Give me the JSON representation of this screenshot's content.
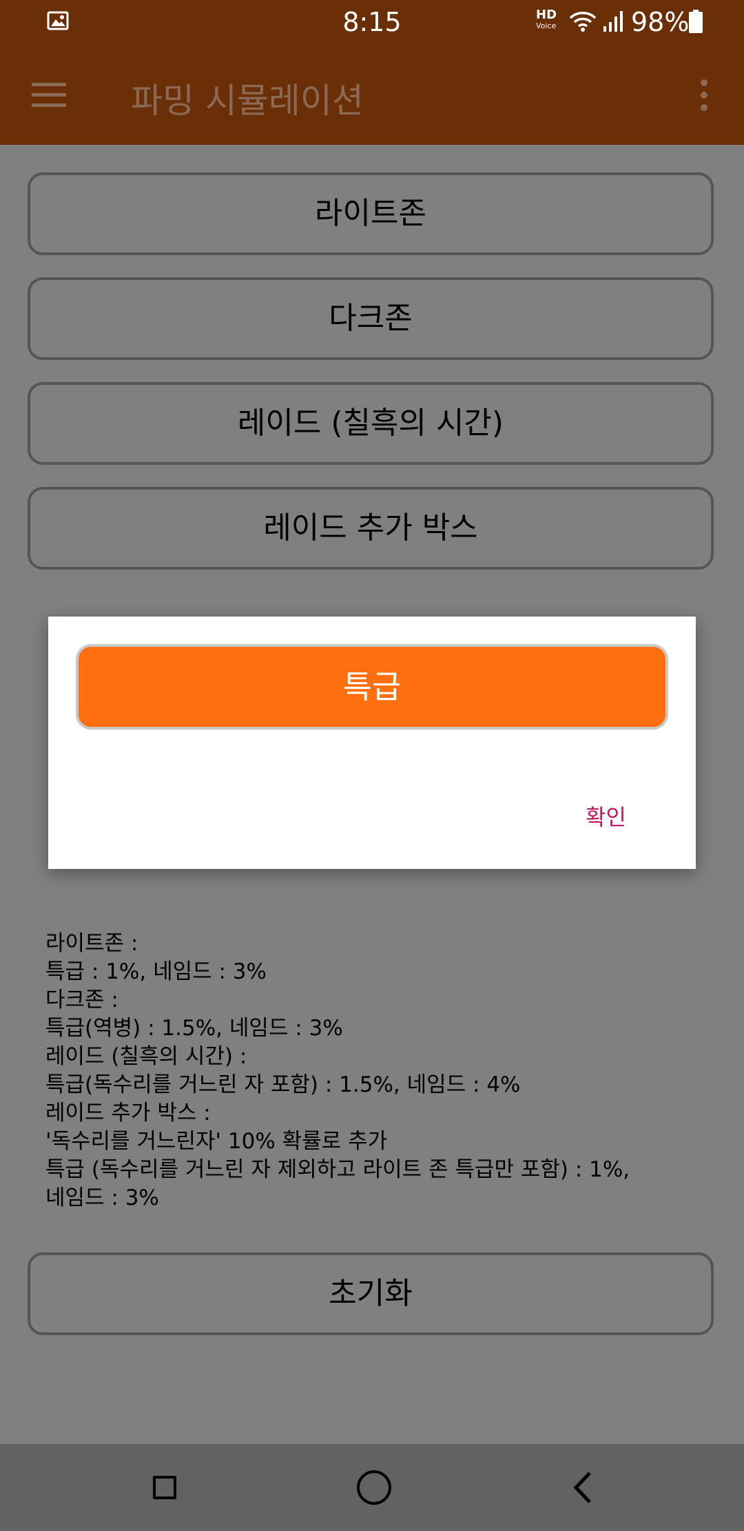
{
  "status_bar": {
    "time": "8:15",
    "hd_label": "HD",
    "voice_label": "Voice",
    "battery_percent": "98%",
    "icons": [
      "gallery-icon",
      "wifi-icon",
      "signal-icon",
      "battery-icon"
    ]
  },
  "app_bar": {
    "title": "파밍 시뮬레이션",
    "icons": [
      "menu-icon",
      "more-vert-icon"
    ]
  },
  "buttons": {
    "light_zone": "라이트존",
    "dark_zone": "다크존",
    "raid": "레이드 (칠흑의 시간)",
    "raid_box": "레이드 추가 박스",
    "reset": "초기화"
  },
  "info_lines": [
    "라이트존 :",
    "특급 : 1%, 네임드 : 3%",
    "다크존 :",
    "특급(역병) : 1.5%, 네임드 : 3%",
    "레이드 (칠흑의 시간) :",
    "특급(독수리를 거느린 자 포함) : 1.5%, 네임드 : 4%",
    "레이드 추가 박스 :",
    "'독수리를 거느린자' 10% 확률로 추가",
    "특급 (독수리를 거느린 자 제외하고 라이트 존 특급만 포함) : 1%,",
    "네임드 : 3%"
  ],
  "dialog": {
    "result_label": "특급",
    "confirm_label": "확인"
  },
  "colors": {
    "app_bar": "#6b2f07",
    "dim_background": "#808080",
    "result_button": "#ff6f10",
    "confirm_text": "#c0185d"
  }
}
